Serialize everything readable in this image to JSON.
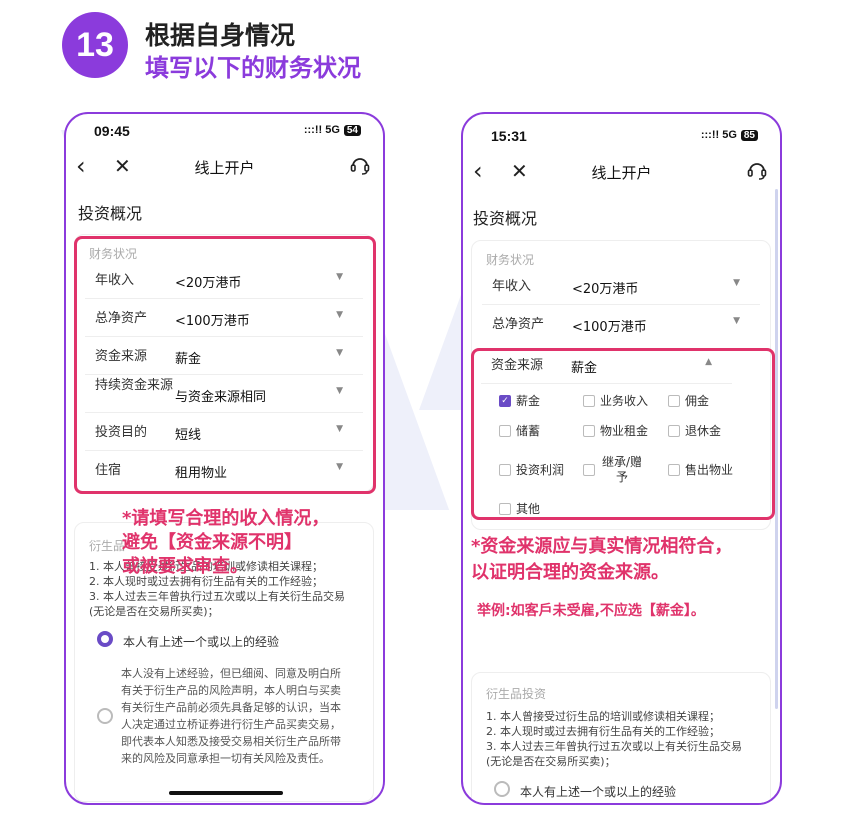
{
  "header": {
    "step": "13",
    "title": "根据自身情况",
    "subtitle": "填写以下的财务状况"
  },
  "left": {
    "time": "09:45",
    "network": ":::!! 5G",
    "battery": "54",
    "nav_title": "线上开户",
    "section": "投资概况",
    "fin_label": "财务状况",
    "rows": [
      {
        "k": "年收入",
        "v": "<20万港币"
      },
      {
        "k": "总净资产",
        "v": "<100万港币"
      },
      {
        "k": "资金来源",
        "v": "薪金"
      },
      {
        "k": "持续资金来源",
        "v": "与资金来源相同"
      },
      {
        "k": "投资目的",
        "v": "短线"
      },
      {
        "k": "住宿",
        "v": "租用物业"
      }
    ],
    "note_lines": [
      "*请填写合理的收入情况，",
      "避免【资金来源不明】",
      "或被要求审查。"
    ],
    "deriv_label": "衍生品",
    "deriv_list": [
      "1. 本人曾接受过衍生品的培训或修读相关课程；",
      "2. 本人现时或过去拥有衍生品有关的工作经验；",
      "3. 本人过去三年曾执行过五次或以上有关衍生品交易",
      "   (无论是否在交易所买卖)；"
    ],
    "radio1": "本人有上述一个或以上的经验",
    "para": [
      "本人没有上述经验，但已细阅、同意及明白所",
      "有关于衍生产品的风险声明，本人明白与买卖",
      "有关衍生产品前必须先具备足够的认识，当本",
      "人决定通过立桥证券进行衍生产品买卖交易，",
      "即代表本人知悉及接受交易相关衍生产品所带",
      "来的风险及同意承担一切有关风险及责任。"
    ]
  },
  "right": {
    "time": "15:31",
    "network": ":::!! 5G",
    "battery": "85",
    "nav_title": "线上开户",
    "section": "投资概况",
    "fin_label": "财务状况",
    "rows": [
      {
        "k": "年收入",
        "v": "<20万港币"
      },
      {
        "k": "总净资产",
        "v": "<100万港币"
      },
      {
        "k": "资金来源",
        "v": "薪金"
      }
    ],
    "options": [
      {
        "label": "薪金",
        "checked": true
      },
      {
        "label": "业务收入",
        "checked": false
      },
      {
        "label": "佣金",
        "checked": false
      },
      {
        "label": "储蓄",
        "checked": false
      },
      {
        "label": "物业租金",
        "checked": false
      },
      {
        "label": "退休金",
        "checked": false
      },
      {
        "label": "投资利润",
        "checked": false
      },
      {
        "label": "继承/赠予",
        "checked": false
      },
      {
        "label": "售出物业",
        "checked": false
      },
      {
        "label": "其他",
        "checked": false
      }
    ],
    "note_lines": [
      "*资金来源应与真实情况相符合，",
      "以证明合理的资金来源。"
    ],
    "example": "举例:如客戶未受雇,不应选【薪金】。",
    "deriv_label": "衍生品投资",
    "deriv_list": [
      "1. 本人曾接受过衍生品的培训或修读相关课程；",
      "2. 本人现时或过去拥有衍生品有关的工作经验；",
      "3. 本人过去三年曾执行过五次或以上有关衍生品交易",
      "   (无论是否在交易所买卖)；"
    ],
    "radio1": "本人有上述一个或以上的经验"
  },
  "colors": {
    "accent": "#8b3bdc",
    "highlight": "#e0336b",
    "check": "#6a4bc6"
  }
}
